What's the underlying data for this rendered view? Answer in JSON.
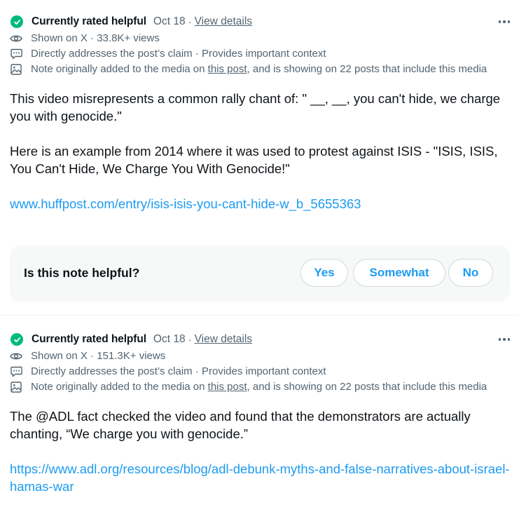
{
  "colors": {
    "check_green": "#00ba7c",
    "link_blue": "#1d9bf0",
    "secondary_text": "#536471",
    "primary_text": "#0f1419",
    "panel_bg": "#f7f9f9"
  },
  "notes": [
    {
      "status": "Currently rated helpful",
      "date": "Oct 18",
      "separator": "·",
      "view_details": "View details",
      "shown_on": "Shown on X · 33.8K+ views",
      "claim": "Directly addresses the post’s claim · Provides important context",
      "media_prefix": "Note originally added to the media on ",
      "media_link": "this post",
      "media_suffix": ", and is showing on 22 posts that include this media",
      "paragraphs": [
        "This video misrepresents a common rally chant of: \" __, __, you can't hide, we charge you with genocide.\"",
        "Here is an example from 2014 where it was used to protest against ISIS - \"ISIS, ISIS, You Can't Hide, We Charge You With Genocide!\""
      ],
      "link": "www.huffpost.com/entry/isis-isis-you-cant-hide-w_b_5655363"
    },
    {
      "status": "Currently rated helpful",
      "date": "Oct 18",
      "separator": "·",
      "view_details": "View details",
      "shown_on": "Shown on X · 151.3K+ views",
      "claim": "Directly addresses the post’s claim · Provides important context",
      "media_prefix": "Note originally added to the media on ",
      "media_link": "this post",
      "media_suffix": ", and is showing on 22 posts that include this media",
      "paragraphs": [
        "The @ADL fact checked the video and found that the demonstrators are actually chanting, “We charge you with genocide.”"
      ],
      "link": "https://www.adl.org/resources/blog/adl-debunk-myths-and-false-narratives-about-israel-hamas-war"
    }
  ],
  "helpful_prompt": {
    "question": "Is this note helpful?",
    "yes": "Yes",
    "somewhat": "Somewhat",
    "no": "No"
  },
  "icons": {
    "status": "check-circle-icon",
    "shown_on": "eye-icon",
    "claim": "speech-bubble-icon",
    "media": "image-icon",
    "more": "more-horizontal-icon"
  }
}
